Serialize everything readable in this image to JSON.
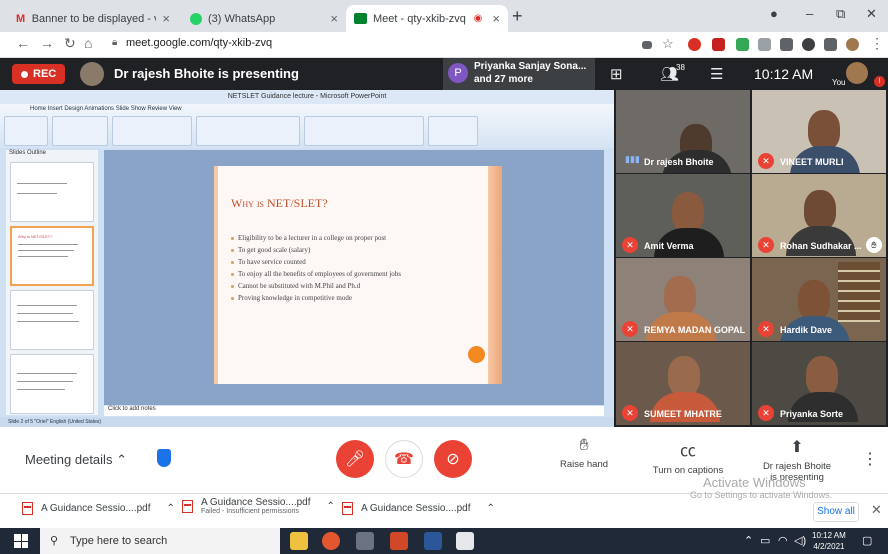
{
  "tabs": [
    {
      "title": "Banner to be displayed - vinit85",
      "icon": "gmail-icon"
    },
    {
      "title": "(3) WhatsApp",
      "icon": "whatsapp-icon"
    },
    {
      "title": "Meet - qty-xkib-zvq",
      "icon": "meet-icon"
    }
  ],
  "address": {
    "url": "meet.google.com/qty-xkib-zvq"
  },
  "meet": {
    "rec_label": "REC",
    "presenting_text": "Dr rajesh Bhoite is presenting",
    "participants_pill": {
      "initial": "P",
      "line1": "Priyanka Sanjay Sona...",
      "line2": "and 27 more"
    },
    "participant_count": "38",
    "clock": "10:12 AM",
    "you_label": "You"
  },
  "ppt": {
    "window_title": "NETSLET Guidance lecture - Microsoft PowerPoint",
    "ribbon_tabs": "Home   Insert   Design   Animations   Slide Show   Review   View",
    "panel_tabs": "Slides   Outline",
    "notes_placeholder": "Click to add notes",
    "status": "Slide 2 of 5    \"Oriel\"    English (United States)",
    "slide": {
      "title": "Why is NET/SLET?",
      "bullets": [
        "Eligibility to be a lecturer in a college on proper post",
        "To get good scale (salary)",
        "To have service counted",
        "To enjoy all the benefits of employees of government jobs",
        "Cannot be substituted with M.Phil and Ph.d",
        "Proving knowledge in competitive mode"
      ]
    },
    "thumbs": [
      "",
      "Why is NET/SLET?",
      "",
      ""
    ]
  },
  "tiles": [
    {
      "name": "Dr rajesh Bhoite",
      "status": "speaking"
    },
    {
      "name": "VINEET MURLI",
      "status": "muted"
    },
    {
      "name": "Amit Verma",
      "status": "muted"
    },
    {
      "name": "Rohan Sudhakar ...",
      "status": "muted",
      "hand": true
    },
    {
      "name": "REMYA MADAN GOPAL",
      "status": "muted"
    },
    {
      "name": "Hardik Dave",
      "status": "muted"
    },
    {
      "name": "SUMEET MHATRE",
      "status": "muted"
    },
    {
      "name": "Priyanka Sorte",
      "status": "muted"
    }
  ],
  "controls": {
    "meeting_details": "Meeting details",
    "raise_hand": "Raise hand",
    "captions": "Turn on captions",
    "presenting_line1": "Dr rajesh Bhoite",
    "presenting_line2": "is presenting",
    "watermark1": "Activate Windows",
    "watermark2": "Go to Settings to activate Windows."
  },
  "downloads": [
    {
      "name": "A Guidance Sessio....pdf",
      "sub": ""
    },
    {
      "name": "A Guidance Sessio....pdf",
      "sub": "Failed - Insufficient permissions"
    },
    {
      "name": "A Guidance Sessio....pdf",
      "sub": ""
    }
  ],
  "show_all": "Show all",
  "taskbar": {
    "search": "Type here to search",
    "time": "10:12 AM",
    "date": "4/2/2021"
  },
  "colors": {
    "red": "#ea4335",
    "meet_dark": "#202124",
    "blue": "#1a73e8"
  }
}
